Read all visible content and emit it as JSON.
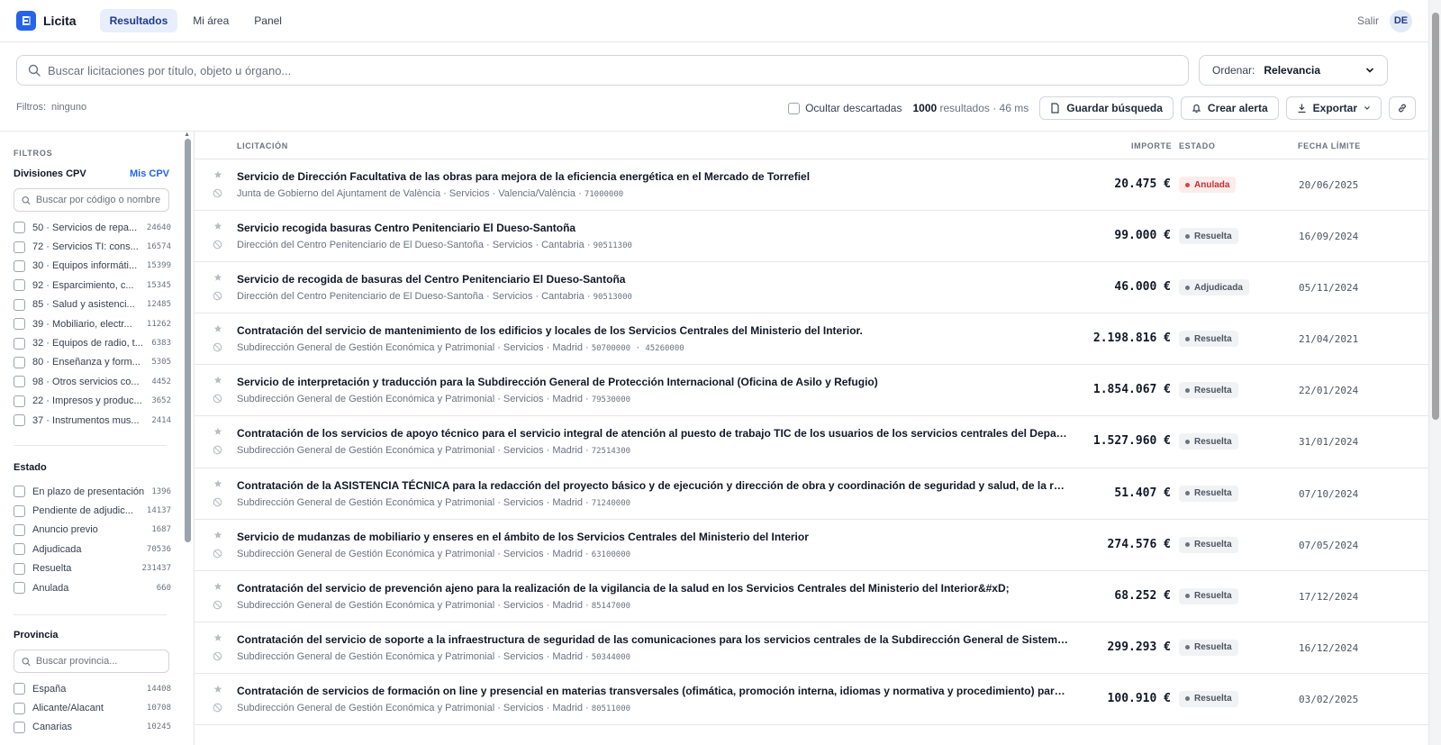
{
  "nav": {
    "brand": "Licita",
    "tabs": [
      {
        "label": "Resultados",
        "active": true
      },
      {
        "label": "Mi área",
        "active": false
      },
      {
        "label": "Panel",
        "active": false
      }
    ],
    "logout": "Salir",
    "avatar": "DE"
  },
  "search": {
    "placeholder": "Buscar licitaciones por título, objeto u órgano...",
    "value": ""
  },
  "sort": {
    "label": "Ordenar:",
    "value": "Relevancia"
  },
  "filters": {
    "label": "Filtros:",
    "value": "ninguno"
  },
  "toolbar": {
    "hide_discarded": "Ocultar descartadas",
    "result_count": "1000",
    "result_suffix": "resultados · 46 ms",
    "save_search": "Guardar búsqueda",
    "create_alert": "Crear alerta",
    "export": "Exportar"
  },
  "sidebar": {
    "title": "FILTROS",
    "cpv": {
      "heading": "Divisiones CPV",
      "link": "Mis CPV",
      "placeholder": "Buscar por código o nombre (p",
      "items": [
        {
          "label": "50 · Servicios de repa...",
          "count": "24640"
        },
        {
          "label": "72 · Servicios TI: cons...",
          "count": "16574"
        },
        {
          "label": "30 · Equipos informáti...",
          "count": "15399"
        },
        {
          "label": "92 · Esparcimiento, c...",
          "count": "15345"
        },
        {
          "label": "85 · Salud y asistenci...",
          "count": "12485"
        },
        {
          "label": "39 · Mobiliario, electr...",
          "count": "11262"
        },
        {
          "label": "32 · Equipos de radio, t...",
          "count": "6383"
        },
        {
          "label": "80 · Enseñanza y form...",
          "count": "5305"
        },
        {
          "label": "98 · Otros servicios co...",
          "count": "4452"
        },
        {
          "label": "22 · Impresos y produc...",
          "count": "3652"
        },
        {
          "label": "37 · Instrumentos mus...",
          "count": "2414"
        }
      ]
    },
    "estado": {
      "heading": "Estado",
      "items": [
        {
          "label": "En plazo de presentación",
          "count": "1396"
        },
        {
          "label": "Pendiente de adjudic...",
          "count": "14137"
        },
        {
          "label": "Anuncio previo",
          "count": "1687"
        },
        {
          "label": "Adjudicada",
          "count": "70536"
        },
        {
          "label": "Resuelta",
          "count": "231437"
        },
        {
          "label": "Anulada",
          "count": "660"
        }
      ]
    },
    "provincia": {
      "heading": "Provincia",
      "placeholder": "Buscar provincia...",
      "items": [
        {
          "label": "España",
          "count": "14408"
        },
        {
          "label": "Alicante/Alacant",
          "count": "10708"
        },
        {
          "label": "Canarias",
          "count": "10245"
        }
      ]
    }
  },
  "table": {
    "headers": {
      "licitacion": "LICITACIÓN",
      "importe": "IMPORTE",
      "estado": "ESTADO",
      "fecha": "FECHA LÍMITE"
    },
    "rows": [
      {
        "title": "Servicio de Dirección Facultativa de las obras para mejora de la eficiencia energética en el Mercado de Torrefiel",
        "meta": "Junta de Gobierno del Ajuntament de València · Servicios · Valencia/València · ",
        "cpv": "71000000",
        "amount": "20.475 €",
        "status": "Anulada",
        "status_color": "#e53e3e",
        "date": "20/06/2025"
      },
      {
        "title": "Servicio recogida basuras Centro Penitenciario El Dueso-Santoña",
        "meta": "Dirección del Centro Penitenciario de El Dueso-Santoña · Servicios · Cantabria · ",
        "cpv": "90511300",
        "amount": "99.000 €",
        "status": "Resuelta",
        "status_color": "#6b7280",
        "date": "16/09/2024"
      },
      {
        "title": "Servicio de recogida de basuras del Centro Penitenciario El Dueso-Santoña",
        "meta": "Dirección del Centro Penitenciario de El Dueso-Santoña · Servicios · Cantabria · ",
        "cpv": "90513000",
        "amount": "46.000 €",
        "status": "Adjudicada",
        "status_color": "#6b7280",
        "date": "05/11/2024"
      },
      {
        "title": "Contratación del servicio de mantenimiento de los edificios y locales de los Servicios Centrales del Ministerio del Interior.",
        "meta": "Subdirección General de Gestión Económica y Patrimonial · Servicios · Madrid · ",
        "cpv": "50700000 · 45260000",
        "amount": "2.198.816 €",
        "status": "Resuelta",
        "status_color": "#6b7280",
        "date": "21/04/2021"
      },
      {
        "title": "Servicio de interpretación y traducción para la Subdirección General de Protección Internacional (Oficina de Asilo y Refugio)",
        "meta": "Subdirección General de Gestión Económica y Patrimonial · Servicios · Madrid · ",
        "cpv": "79530000",
        "amount": "1.854.067 €",
        "status": "Resuelta",
        "status_color": "#6b7280",
        "date": "22/01/2024"
      },
      {
        "title": "Contratación de los servicios de apoyo técnico para el servicio integral de atención al puesto de trabajo TIC de los usuarios de los servicios centrales del Departamento, incl...",
        "meta": "Subdirección General de Gestión Económica y Patrimonial · Servicios · Madrid · ",
        "cpv": "72514300",
        "amount": "1.527.960 €",
        "status": "Resuelta",
        "status_color": "#6b7280",
        "date": "31/01/2024"
      },
      {
        "title": "Contratación de la ASISTENCIA TÉCNICA para la redacción del proyecto básico y de ejecución y dirección de obra y coordinación de seguridad y salud, de la reforma del sal...",
        "meta": "Subdirección General de Gestión Económica y Patrimonial · Servicios · Madrid · ",
        "cpv": "71240000",
        "amount": "51.407 €",
        "status": "Resuelta",
        "status_color": "#6b7280",
        "date": "07/10/2024"
      },
      {
        "title": "Servicio de mudanzas de mobiliario y enseres en el ámbito de los Servicios Centrales del Ministerio del Interior",
        "meta": "Subdirección General de Gestión Económica y Patrimonial · Servicios · Madrid · ",
        "cpv": "63100000",
        "amount": "274.576 €",
        "status": "Resuelta",
        "status_color": "#6b7280",
        "date": "07/05/2024"
      },
      {
        "title": "Contratación del servicio de prevención ajeno para la realización de la vigilancia de la salud en los Servicios Centrales del Ministerio del Interior&#xD;",
        "meta": "Subdirección General de Gestión Económica y Patrimonial · Servicios · Madrid · ",
        "cpv": "85147000",
        "amount": "68.252 €",
        "status": "Resuelta",
        "status_color": "#6b7280",
        "date": "17/12/2024"
      },
      {
        "title": "Contratación del servicio de soporte a la infraestructura de seguridad de las comunicaciones para los servicios centrales de la Subdirección General de Sistemas de Inform...",
        "meta": "Subdirección General de Gestión Económica y Patrimonial · Servicios · Madrid · ",
        "cpv": "50344000",
        "amount": "299.293 €",
        "status": "Resuelta",
        "status_color": "#6b7280",
        "date": "16/12/2024"
      },
      {
        "title": "Contratación de servicios de formación on line y presencial en materias transversales (ofimática, promoción interna, idiomas y normativa y procedimiento) para todos los e...",
        "meta": "Subdirección General de Gestión Económica y Patrimonial · Servicios · Madrid · ",
        "cpv": "80511000",
        "amount": "100.910 €",
        "status": "Resuelta",
        "status_color": "#6b7280",
        "date": "03/02/2025"
      }
    ]
  }
}
